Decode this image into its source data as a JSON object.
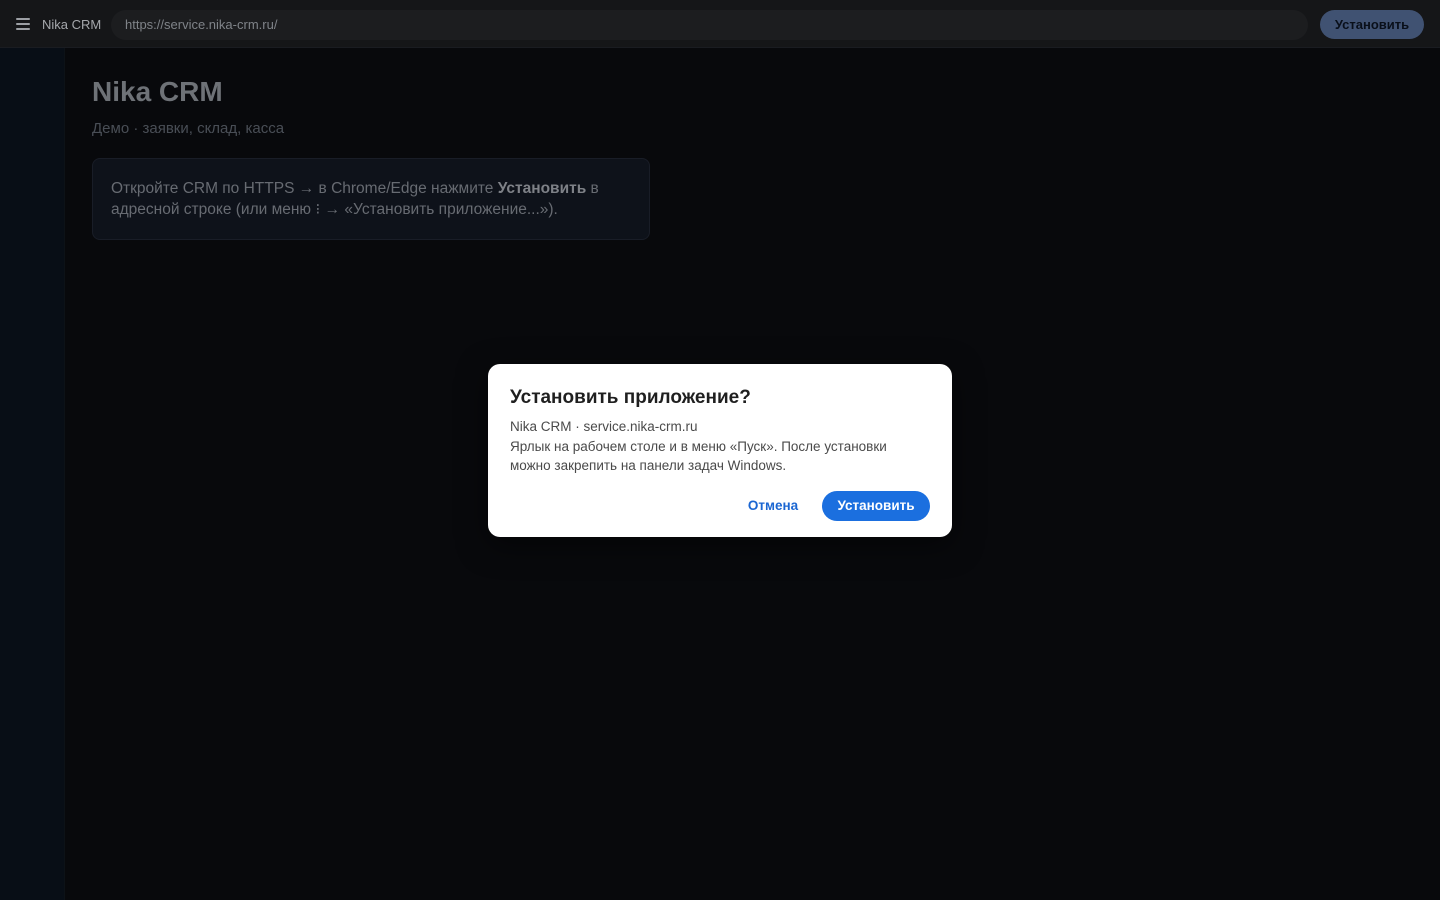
{
  "topbar": {
    "app_name": "Nika CRM",
    "url": "https://service.nika-crm.ru/",
    "install_label": "Установить",
    "menu_icon": "hamburger-menu-icon"
  },
  "page": {
    "title": "Nika CRM",
    "subtitle": "Демо · заявки, склад, касса",
    "info_prefix": "Откройте CRM по HTTPS → в Chrome/Edge нажмите ",
    "info_bold": "Установить",
    "info_suffix": " в адресной строке (или меню ⁝ → «Установить приложение...»)."
  },
  "dialog": {
    "title": "Установить приложение?",
    "origin": "Nika CRM · service.nika-crm.ru",
    "description": "Ярлык на рабочем столе и в меню «Пуск». После установки можно закрепить на панели задач Windows.",
    "cancel_label": "Отмена",
    "install_label": "Установить"
  }
}
